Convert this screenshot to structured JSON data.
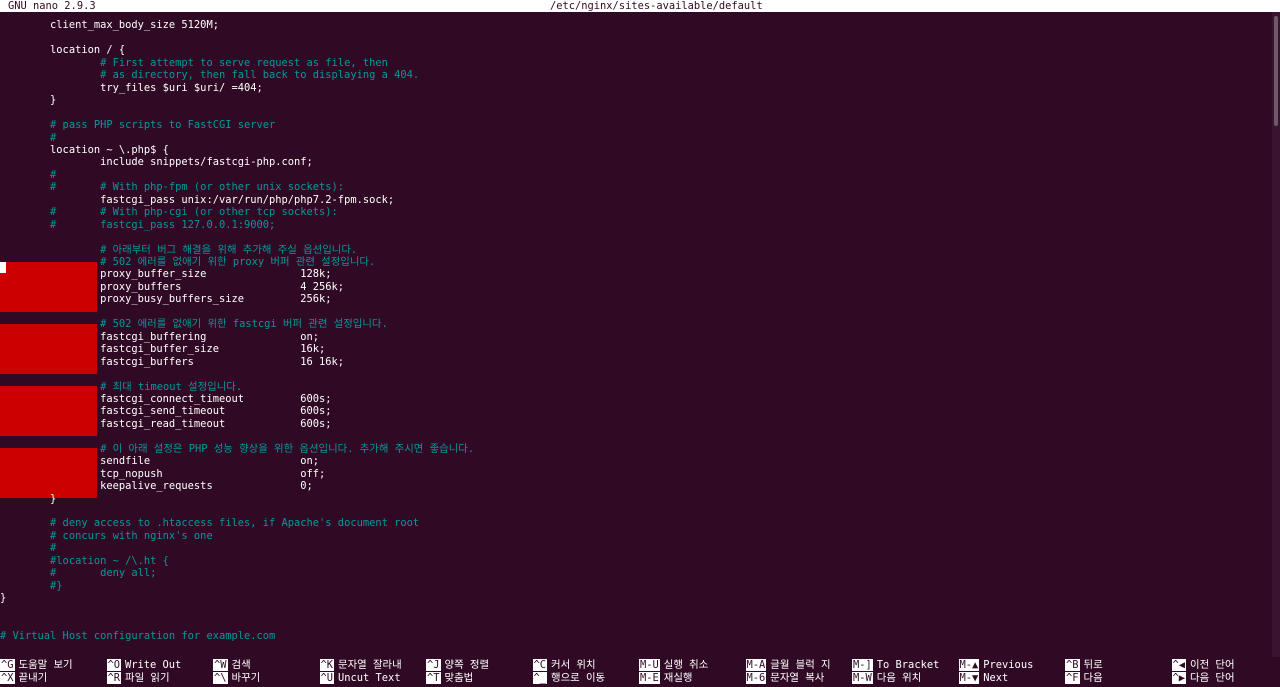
{
  "titlebar": {
    "app": "GNU nano 2.9.3",
    "file": "/etc/nginx/sites-available/default"
  },
  "editor": {
    "lines": [
      {
        "text": "        client_max_body_size 5120M;",
        "type": "code",
        "row": 1
      },
      {
        "text": "        location / {",
        "type": "code",
        "row": 3
      },
      {
        "text": "                # First attempt to serve request as file, then",
        "type": "comment",
        "row": 4
      },
      {
        "text": "                # as directory, then fall back to displaying a 404.",
        "type": "comment",
        "row": 5
      },
      {
        "text": "                try_files $uri $uri/ =404;",
        "type": "code",
        "row": 6
      },
      {
        "text": "        }",
        "type": "code",
        "row": 7
      },
      {
        "text": "        # pass PHP scripts to FastCGI server",
        "type": "comment",
        "row": 9
      },
      {
        "text": "        #",
        "type": "comment",
        "row": 10
      },
      {
        "text": "        location ~ \\.php$ {",
        "type": "code",
        "row": 11
      },
      {
        "text": "                include snippets/fastcgi-php.conf;",
        "type": "code",
        "row": 12
      },
      {
        "text": "        #",
        "type": "comment",
        "row": 13
      },
      {
        "text": "        #       # With php-fpm (or other unix sockets):",
        "type": "comment",
        "row": 14
      },
      {
        "text": "                fastcgi_pass unix:/var/run/php/php7.2-fpm.sock;",
        "type": "code",
        "row": 15
      },
      {
        "text": "        #       # With php-cgi (or other tcp sockets):",
        "type": "comment",
        "row": 16
      },
      {
        "text": "        #       fastcgi_pass 127.0.0.1:9000;",
        "type": "comment",
        "row": 17
      },
      {
        "text": "                # 아래부터 버그 해결을 위해 추가해 주실 옵션입니다.",
        "type": "comment",
        "row": 19
      },
      {
        "text": "                # 502 에러를 없애기 위한 proxy 버퍼 관련 설정입니다.",
        "type": "comment",
        "row": 20
      },
      {
        "text": "                proxy_buffer_size               128k;",
        "type": "code",
        "row": 21
      },
      {
        "text": "                proxy_buffers                   4 256k;",
        "type": "code",
        "row": 22
      },
      {
        "text": "                proxy_busy_buffers_size         256k;",
        "type": "code",
        "row": 23
      },
      {
        "text": "                # 502 에러를 없애기 위한 fastcgi 버퍼 관련 설정입니다.",
        "type": "comment",
        "row": 25
      },
      {
        "text": "                fastcgi_buffering               on;",
        "type": "code",
        "row": 26
      },
      {
        "text": "                fastcgi_buffer_size             16k;",
        "type": "code",
        "row": 27
      },
      {
        "text": "                fastcgi_buffers                 16 16k;",
        "type": "code",
        "row": 28
      },
      {
        "text": "                # 최대 timeout 설정입니다.",
        "type": "comment",
        "row": 30
      },
      {
        "text": "                fastcgi_connect_timeout         600s;",
        "type": "code",
        "row": 31
      },
      {
        "text": "                fastcgi_send_timeout            600s;",
        "type": "code",
        "row": 32
      },
      {
        "text": "                fastcgi_read_timeout            600s;",
        "type": "code",
        "row": 33
      },
      {
        "text": "                # 이 아래 설정은 PHP 성능 향상을 위한 옵션입니다. 추가해 주시면 좋습니다.",
        "type": "comment",
        "row": 35
      },
      {
        "text": "                sendfile                        on;",
        "type": "code",
        "row": 36
      },
      {
        "text": "                tcp_nopush                      off;",
        "type": "code",
        "row": 37
      },
      {
        "text": "                keepalive_requests              0;",
        "type": "code",
        "row": 38
      },
      {
        "text": "        }",
        "type": "code",
        "row": 39
      },
      {
        "text": "        # deny access to .htaccess files, if Apache's document root",
        "type": "comment",
        "row": 41
      },
      {
        "text": "        # concurs with nginx's one",
        "type": "comment",
        "row": 42
      },
      {
        "text": "        #",
        "type": "comment",
        "row": 43
      },
      {
        "text": "        #location ~ /\\.ht {",
        "type": "comment",
        "row": 44
      },
      {
        "text": "        #       deny all;",
        "type": "comment",
        "row": 45
      },
      {
        "text": "        #}",
        "type": "comment",
        "row": 46
      },
      {
        "text": "}",
        "type": "code",
        "row": 47
      },
      {
        "text": "# Virtual Host configuration for example.com",
        "type": "comment",
        "row": 50
      }
    ]
  },
  "shortcuts": [
    {
      "key": "^G",
      "label": "도움말 보기",
      "col": 0,
      "row": 0
    },
    {
      "key": "^X",
      "label": "끝내기",
      "col": 0,
      "row": 1
    },
    {
      "key": "^O",
      "label": "Write Out",
      "col": 1,
      "row": 0
    },
    {
      "key": "^R",
      "label": "파일 읽기",
      "col": 1,
      "row": 1
    },
    {
      "key": "^W",
      "label": "검색",
      "col": 2,
      "row": 0
    },
    {
      "key": "^\\",
      "label": "바꾸기",
      "col": 2,
      "row": 1
    },
    {
      "key": "^K",
      "label": "문자열 잘라내",
      "col": 3,
      "row": 0
    },
    {
      "key": "^U",
      "label": "Uncut Text",
      "col": 3,
      "row": 1
    },
    {
      "key": "^J",
      "label": "양쪽 정렬",
      "col": 4,
      "row": 0
    },
    {
      "key": "^T",
      "label": "맞춤법",
      "col": 4,
      "row": 1
    },
    {
      "key": "^C",
      "label": "커서 위치",
      "col": 5,
      "row": 0
    },
    {
      "key": "^_",
      "label": "행으로 이동",
      "col": 5,
      "row": 1
    },
    {
      "key": "M-U",
      "label": "실행 취소",
      "col": 6,
      "row": 0
    },
    {
      "key": "M-E",
      "label": "재실행",
      "col": 6,
      "row": 1
    },
    {
      "key": "M-A",
      "label": "글월 블럭 지",
      "col": 7,
      "row": 0
    },
    {
      "key": "M-6",
      "label": "문자열 복사",
      "col": 7,
      "row": 1
    },
    {
      "key": "M-]",
      "label": "To Bracket",
      "col": 8,
      "row": 0
    },
    {
      "key": "M-W",
      "label": "다음 위치",
      "col": 8,
      "row": 1
    },
    {
      "key": "M-▲",
      "label": "Previous",
      "col": 9,
      "row": 0
    },
    {
      "key": "M-▼",
      "label": "Next",
      "col": 9,
      "row": 1
    },
    {
      "key": "^B",
      "label": "뒤로",
      "col": 10,
      "row": 0
    },
    {
      "key": "^F",
      "label": "다음",
      "col": 10,
      "row": 1
    },
    {
      "key": "^◀",
      "label": "이전 단어",
      "col": 11,
      "row": 0
    },
    {
      "key": "^▶",
      "label": "다음 단어",
      "col": 11,
      "row": 1
    }
  ]
}
